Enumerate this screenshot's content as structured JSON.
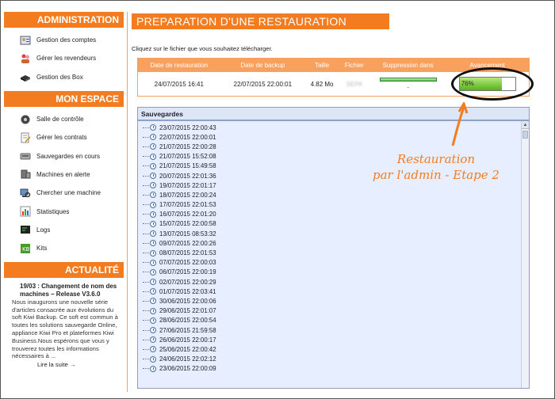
{
  "sidebar": {
    "administration": {
      "title": "ADMINISTRATION",
      "items": [
        {
          "label": "Gestion des comptes",
          "icon": "accounts-icon"
        },
        {
          "label": "Gérer les revendeurs",
          "icon": "resellers-icon"
        },
        {
          "label": "Gestion des Box",
          "icon": "box-icon"
        }
      ]
    },
    "mon_espace": {
      "title": "MON ESPACE",
      "items": [
        {
          "label": "Salle de contrôle",
          "icon": "control-room-icon"
        },
        {
          "label": "Gérer les contrats",
          "icon": "contracts-icon"
        },
        {
          "label": "Sauvegardes en cours",
          "icon": "backups-icon"
        },
        {
          "label": "Machines en alerte",
          "icon": "alert-machines-icon"
        },
        {
          "label": "Chercher une machine",
          "icon": "search-machine-icon"
        },
        {
          "label": "Statistiques",
          "icon": "statistics-icon"
        },
        {
          "label": "Logs",
          "icon": "logs-icon"
        },
        {
          "label": "Kits",
          "icon": "kits-icon"
        }
      ]
    },
    "actualite": {
      "title": "ACTUALITÉ",
      "news_title": "19/03 : Changement de nom des machines – Release V3.6.0",
      "news_body": "Nous inaugurons une nouvelle série d'articles consacrée aux évolutions du soft Kiwi Backup. Ce soft est commun à toutes les solutions sauvegarde Online, appliance Kiwi Pro et plateformes Kiwi Business.Nous espérons que vous y trouverez toutes les informations nécessaires à ...",
      "read_more": "Lire la suite →"
    }
  },
  "main": {
    "title": "PREPARATION D'UNE RESTAURATION",
    "instruction": "Cliquez sur le fichier que vous souhaitez télécharger.",
    "restore_table": {
      "headers": [
        "Date de restauration",
        "Date de backup",
        "Taille",
        "Fichier",
        "Suppression dans",
        "Avancement"
      ],
      "row": {
        "restore_date": "24/07/2015 16:41",
        "backup_date": "22/07/2015 22:00:01",
        "size": "4.82 Mo",
        "file": "SEPA",
        "suppression_fraction": 1.0,
        "suppression_text": "-",
        "progress_label": "76%",
        "progress_fraction": 0.76
      }
    },
    "tree": {
      "header": "Sauvegardes",
      "items": [
        "23/07/2015 22:00:43",
        "22/07/2015 22:00:01",
        "21/07/2015 22:00:28",
        "21/07/2015 15:52:08",
        "21/07/2015 15:49:58",
        "20/07/2015 22:01:36",
        "19/07/2015 22:01:17",
        "18/07/2015 22:00:24",
        "17/07/2015 22:01:53",
        "16/07/2015 22:01:20",
        "15/07/2015 22:00:58",
        "13/07/2015 08:53:32",
        "09/07/2015 22:00:26",
        "08/07/2015 22:01:53",
        "07/07/2015 22:00:03",
        "06/07/2015 22:00:19",
        "02/07/2015 22:00:29",
        "01/07/2015 22:03:41",
        "30/06/2015 22:00:06",
        "29/06/2015 22:01:07",
        "28/06/2015 22:00:54",
        "27/06/2015 21:59:58",
        "26/06/2015 22:00:17",
        "25/06/2015 22:00:42",
        "24/06/2015 22:02:12",
        "23/06/2015 22:00:09"
      ]
    }
  },
  "annotation": {
    "line1": "Restauration",
    "line2": "par l'admin - Etape 2",
    "color": "#f47c20"
  },
  "colors": {
    "accent": "#f47c20",
    "progress": "#56b21c",
    "tree_bg": "#e6eeff"
  }
}
